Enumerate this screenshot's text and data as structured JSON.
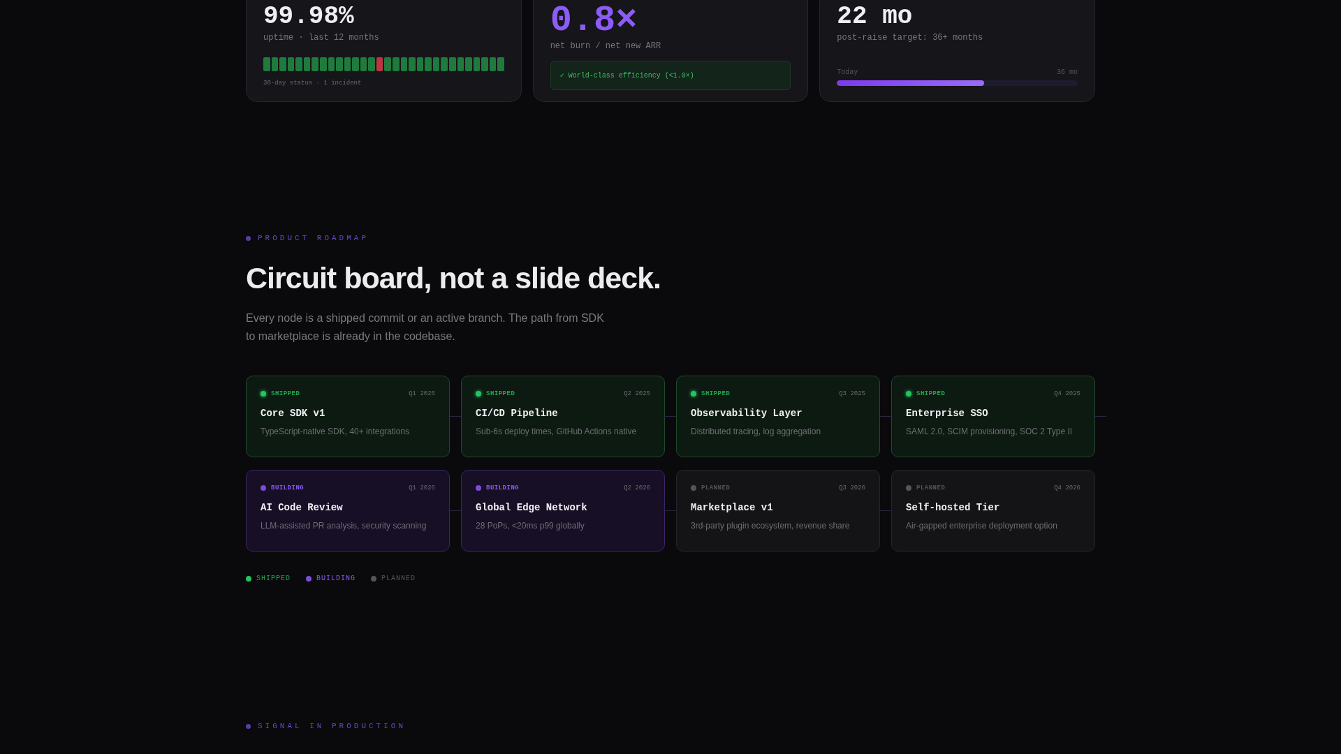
{
  "metrics": [
    {
      "kind": "uptime",
      "value": "99.98%",
      "caption": "uptime · last 12 months",
      "status_days": [
        {
          "incident": false
        },
        {
          "incident": false
        },
        {
          "incident": false
        },
        {
          "incident": false
        },
        {
          "incident": false
        },
        {
          "incident": false
        },
        {
          "incident": false
        },
        {
          "incident": false
        },
        {
          "incident": false
        },
        {
          "incident": false
        },
        {
          "incident": false
        },
        {
          "incident": false
        },
        {
          "incident": false
        },
        {
          "incident": false
        },
        {
          "incident": true
        },
        {
          "incident": false
        },
        {
          "incident": false
        },
        {
          "incident": false
        },
        {
          "incident": false
        },
        {
          "incident": false
        },
        {
          "incident": false
        },
        {
          "incident": false
        },
        {
          "incident": false
        },
        {
          "incident": false
        },
        {
          "incident": false
        },
        {
          "incident": false
        },
        {
          "incident": false
        },
        {
          "incident": false
        },
        {
          "incident": false
        },
        {
          "incident": false
        }
      ],
      "note": "30-day status · 1 incident"
    },
    {
      "kind": "ratio",
      "value": "0.8×",
      "caption": "net burn / net new ARR",
      "badge": "✓ World-class efficiency (<1.0×)"
    },
    {
      "kind": "runway",
      "value": "22 mo",
      "caption": "post-raise target: 36+ months",
      "start_label": "Today",
      "end_label": "36 mo",
      "level": 0.61
    }
  ],
  "roadmap": {
    "eyebrow": "PRODUCT ROADMAP",
    "title": "Circuit board, not a slide deck.",
    "intro": "Every node is a shipped commit or an active branch. The path from SDK to marketplace is already in the codebase.",
    "items": [
      {
        "kind": "done",
        "status_label": "SHIPPED",
        "quarter": "Q1 2025",
        "title": "Core SDK v1",
        "description": "TypeScript-native SDK, 40+ integrations"
      },
      {
        "kind": "done",
        "status_label": "SHIPPED",
        "quarter": "Q2 2025",
        "title": "CI/CD Pipeline",
        "description": "Sub-6s deploy times, GitHub Actions native"
      },
      {
        "kind": "done",
        "status_label": "SHIPPED",
        "quarter": "Q3 2025",
        "title": "Observability Layer",
        "description": "Distributed tracing, log aggregation"
      },
      {
        "kind": "done",
        "status_label": "SHIPPED",
        "quarter": "Q4 2025",
        "title": "Enterprise SSO",
        "description": "SAML 2.0, SCIM provisioning, SOC 2 Type II"
      },
      {
        "kind": "active",
        "status_label": "BUILDING",
        "quarter": "Q1 2026",
        "title": "AI Code Review",
        "description": "LLM-assisted PR analysis, security scanning"
      },
      {
        "kind": "active",
        "status_label": "BUILDING",
        "quarter": "Q2 2026",
        "title": "Global Edge Network",
        "description": "28 PoPs, <20ms p99 globally"
      },
      {
        "kind": "future",
        "status_label": "PLANNED",
        "quarter": "Q3 2026",
        "title": "Marketplace v1",
        "description": "3rd-party plugin ecosystem, revenue share"
      },
      {
        "kind": "future",
        "status_label": "PLANNED",
        "quarter": "Q4 2026",
        "title": "Self-hosted Tier",
        "description": "Air-gapped enterprise deployment option"
      }
    ],
    "legend": [
      {
        "kind": "done",
        "label": "SHIPPED"
      },
      {
        "kind": "active",
        "label": "BUILDING"
      },
      {
        "kind": "future",
        "label": "PLANNED"
      }
    ]
  },
  "next_section": {
    "eyebrow": "SIGNAL IN PRODUCTION"
  }
}
